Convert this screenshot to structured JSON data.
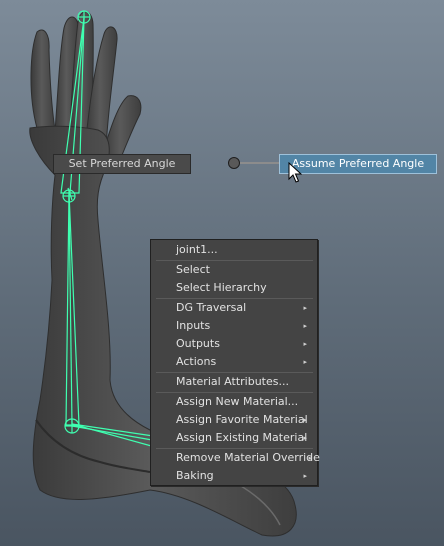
{
  "marking_menu": {
    "set_preferred_angle": "Set Preferred Angle",
    "assume_preferred_angle": "Assume Preferred Angle"
  },
  "context_menu": {
    "header": "joint1...",
    "select": "Select",
    "select_hierarchy": "Select Hierarchy",
    "dg_traversal": "DG Traversal",
    "inputs": "Inputs",
    "outputs": "Outputs",
    "actions": "Actions",
    "material_attributes": "Material Attributes...",
    "assign_new_material": "Assign New Material...",
    "assign_favorite_material": "Assign Favorite Material",
    "assign_existing_material": "Assign Existing Material",
    "remove_material_override": "Remove Material Override",
    "baking": "Baking",
    "submenu_arrow": "▸"
  },
  "colors": {
    "viewport_background": "#6f7d8b",
    "arm_mesh": "#4d4d4d",
    "skeleton_joint": "#3fffb0",
    "highlight_button": "#5285a6"
  }
}
